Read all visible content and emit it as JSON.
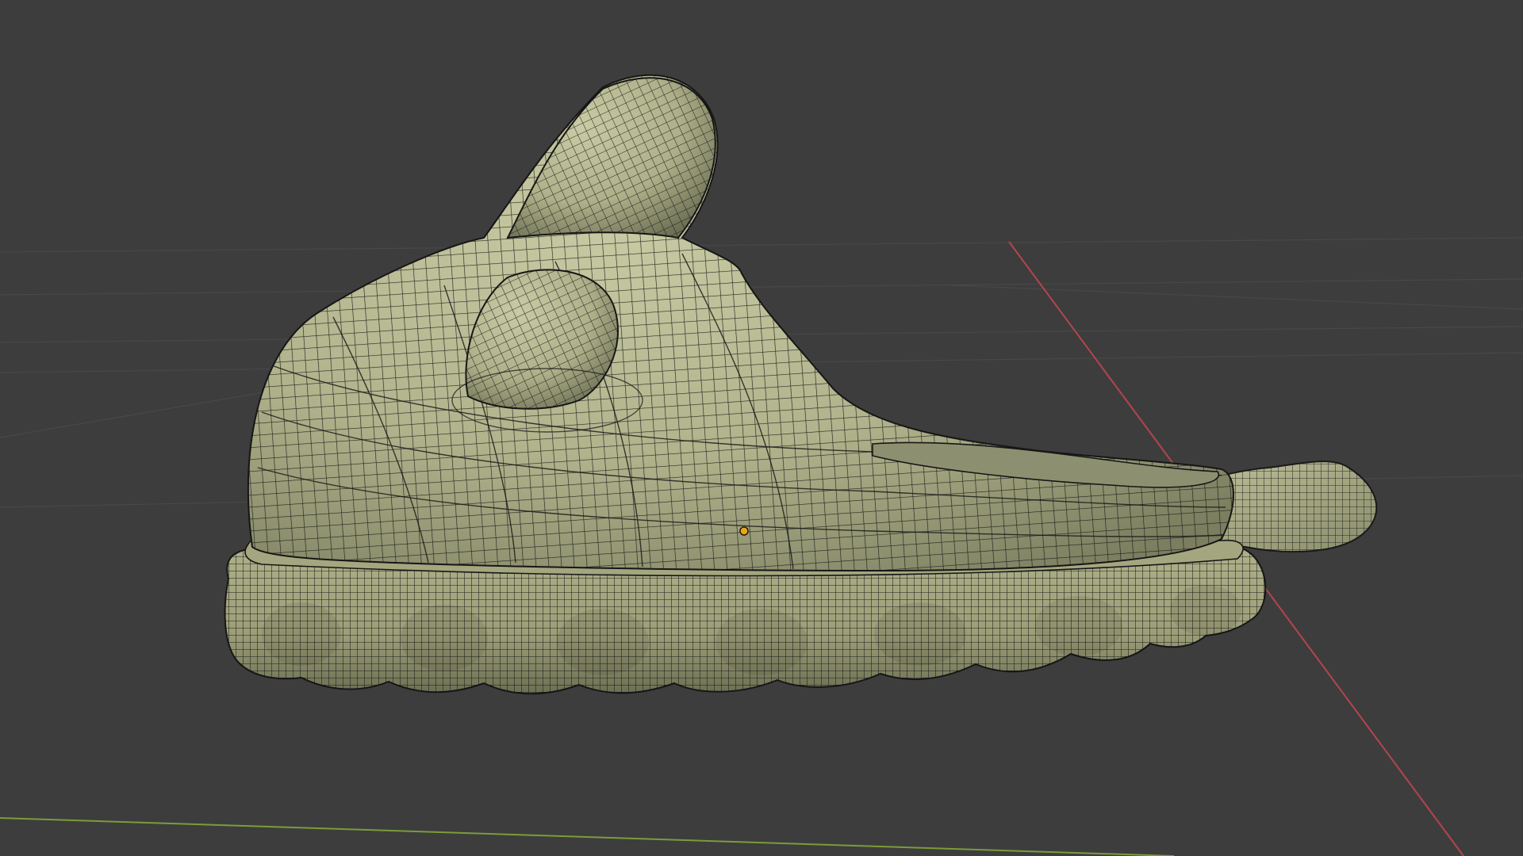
{
  "viewport": {
    "background": "#3d3d3d",
    "grid_color": "#4a4a4a",
    "axis_x_color": "#b5464f",
    "axis_y_color": "#7a9a3a",
    "wire_color": "#141414",
    "object": {
      "fill_light": "#c4c69f",
      "fill_base": "#aeb089",
      "fill_shadow": "#6f7255",
      "origin_color": "#e8a81e"
    }
  }
}
